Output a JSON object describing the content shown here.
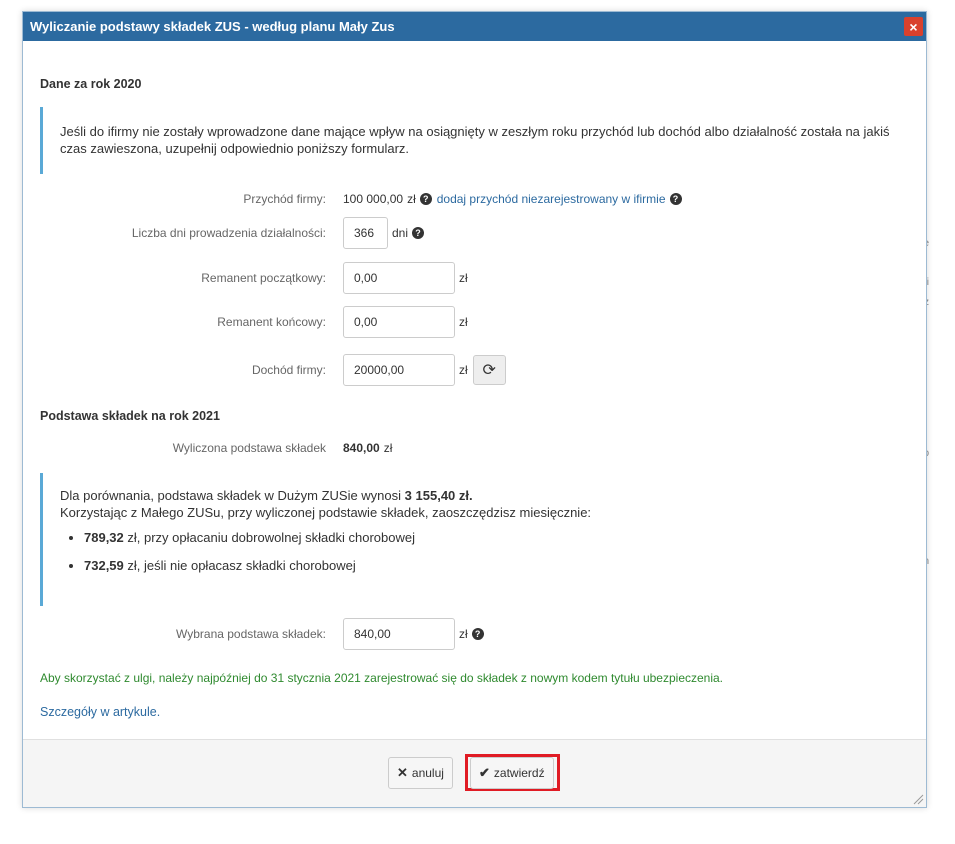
{
  "dialog": {
    "title": "Wyliczanie podstawy składek ZUS - według planu Mały Zus",
    "close_label": "×"
  },
  "section_2020": {
    "title": "Dane za rok 2020",
    "info_text": "Jeśli do ifirmy nie zostały wprowadzone dane mające wpływ na osiągnięty w zeszłym roku przychód lub dochód albo działalność została na jakiś czas zawieszona, uzupełnij odpowiednio poniższy formularz.",
    "revenue": {
      "label": "Przychód firmy:",
      "value": "100 000,00",
      "unit": "zł",
      "link": "dodaj przychód niezarejestrowany w ifirmie"
    },
    "days": {
      "label": "Liczba dni prowadzenia działalności:",
      "value": "366",
      "unit": "dni"
    },
    "stock_start": {
      "label": "Remanent początkowy:",
      "value": "0,00",
      "unit": "zł"
    },
    "stock_end": {
      "label": "Remanent końcowy:",
      "value": "0,00",
      "unit": "zł"
    },
    "income": {
      "label": "Dochód firmy:",
      "value": "20000,00",
      "unit": "zł"
    }
  },
  "section_2021": {
    "title": "Podstawa składek na rok 2021",
    "computed": {
      "label": "Wyliczona podstawa składek",
      "value": "840,00",
      "unit": "zł"
    },
    "comparison": {
      "line1_prefix": "Dla porównania, podstawa składek w Dużym ZUSie wynosi",
      "line1_amount": "3 155,40 zł.",
      "line2": "Korzystając z Małego ZUSu, przy wyliczonej podstawie składek, zaoszczędzisz miesięcznie:",
      "items": [
        {
          "amount": "789,32",
          "text": "zł, przy opłacaniu dobrowolnej składki chorobowej"
        },
        {
          "amount": "732,59",
          "text": "zł, jeśli nie opłacasz składki chorobowej"
        }
      ]
    },
    "selected": {
      "label": "Wybrana podstawa składek:",
      "value": "840,00",
      "unit": "zł"
    }
  },
  "notes": {
    "green": "Aby skorzystać z ulgi, należy najpóźniej do 31 stycznia 2021 zarejestrować się do składek z nowym kodem tytułu ubezpieczenia.",
    "details_link": "Szczegóły w artykule."
  },
  "footer": {
    "cancel_label": "anuluj",
    "confirm_label": "zatwierdź"
  },
  "icons": {
    "help": "question-circle-icon",
    "refresh": "refresh-icon",
    "cancel": "times-icon",
    "confirm": "check-icon"
  },
  "colors": {
    "titlebar": "#2c6aa0",
    "close": "#d9412d",
    "info_border": "#5aa9d6",
    "link": "#2c6aa0",
    "green_note": "#2f8a2f",
    "highlight": "#e01b24"
  }
}
